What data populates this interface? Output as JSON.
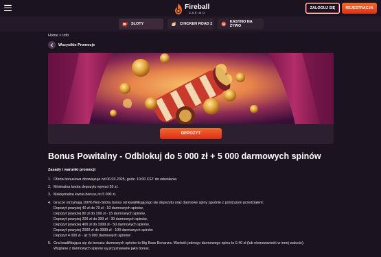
{
  "header": {
    "logo_main": "Fireball",
    "logo_sub": "CASINO",
    "login_label": "ZALOGUJ SIĘ",
    "register_label": "REJESTRACJA"
  },
  "subnav": {
    "items": [
      {
        "label": "SLOTY",
        "icon": "slot-machine-icon"
      },
      {
        "label": "CHICKEN ROAD 2",
        "icon": "chicken-icon"
      },
      {
        "label": "KASYNO NA ŻYWO",
        "icon": "roulette-icon"
      }
    ]
  },
  "breadcrumb": "Home > Info",
  "back_label": "Wszystkie Promocje",
  "banner": {
    "deposit_label": "DEPOZYT"
  },
  "promo": {
    "title": "Bonus Powitalny - Odblokuj do 5 000 zł + 5 000 darmowych spinów",
    "rules_heading": "Zasady i warunki promocji",
    "rules": [
      {
        "num": "1.",
        "lines": [
          "Oferta bonusowa obowiązuje od 06.03.2025, godz. 10:00 CET do odwołania."
        ]
      },
      {
        "num": "2.",
        "lines": [
          "Minimalna kwota depozytu wynosi 20 zł."
        ]
      },
      {
        "num": "3.",
        "lines": [
          "Maksymalna kwota bonusu to 5 000 zł."
        ]
      },
      {
        "num": "4.",
        "lines": [
          "Gracze otrzymają 100% Non-Sticky bonus od kwalifikującego się depozytu oraz darmowe spiny zgodnie z poniższym przedziałem:",
          "Depozyt powyżej 40 zł do 79 zł - 10 darmowych spinów,",
          "Depozyt powyżej 80 zł do 199 zł - 15 darmowych spinów,",
          "Depozyt powyżej 200 zł do 399 zł - 30 darmowych spinów,",
          "Depozyt powyżej 400 zł do 1999 zł - 50 darmowych spinów,",
          "Depozyt powyżej 2000 zł do 3999 zł - 100 darmowych spinów",
          "Depozyt 4 000 zł - aż 5 000 darmowych spinów!"
        ]
      },
      {
        "num": "5.",
        "lines": [
          "Gra kwalifikująca się do bonusu darmowych spinów to Big Bass Bonanza. Wartość jednego darmowego spinu to 0.40 zł (lub równowartość w innej walucie).",
          "Wygrane z darmowych spinów są przyznawane jako bonus."
        ]
      }
    ]
  },
  "colors": {
    "background": "#1b1320",
    "subnav": "#241929",
    "accent": "#e0301d",
    "accent_light": "#f06b25"
  }
}
